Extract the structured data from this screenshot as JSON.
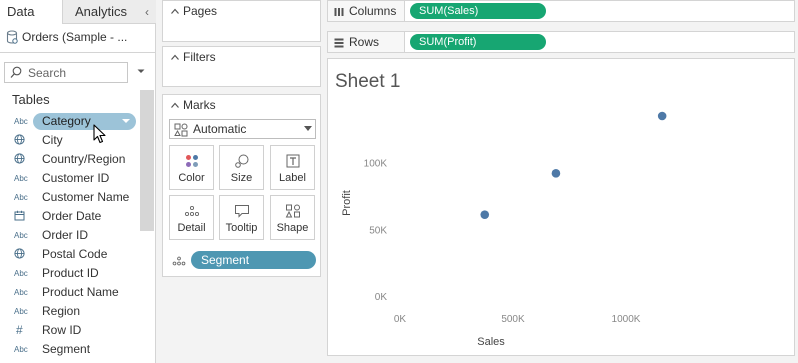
{
  "data_pane": {
    "tabs": {
      "data": "Data",
      "analytics": "Analytics"
    },
    "collapse_glyph": "‹",
    "datasource": "Orders (Sample - ...",
    "search": {
      "placeholder": "Search"
    },
    "tables_heading": "Tables",
    "fields": [
      {
        "type": "Abc",
        "icon": "abc-icon",
        "name": "Category",
        "selected": true
      },
      {
        "type": "geo",
        "icon": "globe-icon",
        "name": "City"
      },
      {
        "type": "geo",
        "icon": "globe-icon",
        "name": "Country/Region"
      },
      {
        "type": "Abc",
        "icon": "abc-icon",
        "name": "Customer ID"
      },
      {
        "type": "Abc",
        "icon": "abc-icon",
        "name": "Customer Name"
      },
      {
        "type": "date",
        "icon": "calendar-icon",
        "name": "Order Date"
      },
      {
        "type": "Abc",
        "icon": "abc-icon",
        "name": "Order ID"
      },
      {
        "type": "geo",
        "icon": "globe-icon",
        "name": "Postal Code"
      },
      {
        "type": "Abc",
        "icon": "abc-icon",
        "name": "Product ID"
      },
      {
        "type": "Abc",
        "icon": "abc-icon",
        "name": "Product Name"
      },
      {
        "type": "Abc",
        "icon": "abc-icon",
        "name": "Region"
      },
      {
        "type": "#",
        "icon": "hash-icon",
        "name": "Row ID"
      },
      {
        "type": "Abc",
        "icon": "abc-icon",
        "name": "Segment"
      }
    ]
  },
  "cards": {
    "pages": "Pages",
    "filters": "Filters",
    "marks": {
      "title": "Marks",
      "mark_type": "Automatic",
      "buttons": {
        "color": "Color",
        "size": "Size",
        "label": "Label",
        "detail": "Detail",
        "tooltip": "Tooltip",
        "shape": "Shape"
      },
      "detail_pill": "Segment"
    }
  },
  "shelves": {
    "columns": {
      "label": "Columns",
      "pill": "SUM(Sales)"
    },
    "rows": {
      "label": "Rows",
      "pill": "SUM(Profit)"
    }
  },
  "sheet": {
    "title": "Sheet 1"
  },
  "colors": {
    "measure_pill": "#17a672",
    "dimension_pill": "#4e97b2",
    "selected_field": "#9cc3d8",
    "mark": "#4e79a7"
  },
  "chart_data": {
    "type": "scatter",
    "title": "Sheet 1",
    "xlabel": "Sales",
    "ylabel": "Profit",
    "x_ticks": [
      "0K",
      "500K",
      "1000K"
    ],
    "y_ticks": [
      "0K",
      "50K",
      "100K"
    ],
    "xlim": [
      0,
      1300000
    ],
    "ylim": [
      0,
      135000
    ],
    "grid": false,
    "points": [
      {
        "x": 375000,
        "y": 61000
      },
      {
        "x": 690000,
        "y": 92000
      },
      {
        "x": 1160000,
        "y": 135000
      }
    ]
  }
}
